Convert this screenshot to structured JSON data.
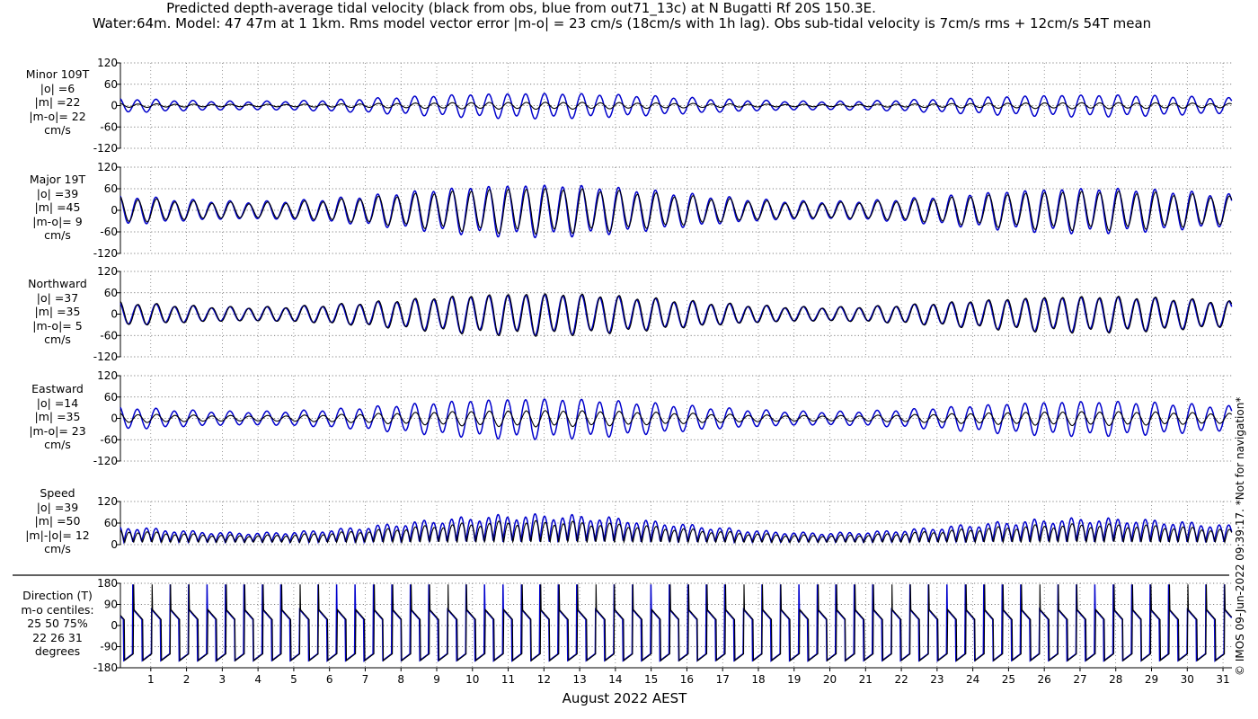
{
  "title": {
    "line1": "Predicted depth-average tidal velocity (black from obs, blue from out71_13c) at N Bugatti Rf 20S 150.3E.",
    "line2": "Water:64m. Model: 47 47m at 1 1km. Rms model vector error |m-o| = 23 cm/s (18cm/s with 1h lag). Obs sub-tidal velocity is 7cm/s rms + 12cm/s 54T mean"
  },
  "copyright": "© IMOS 09-Jun-2022 09:39:17. *Not for navigation*",
  "colors": {
    "obs": "#000000",
    "model": "#0000cc",
    "grid": "#555555"
  },
  "chart_data": [
    {
      "type": "line",
      "id": "minor",
      "label_lines": [
        "Minor 109T",
        "|o| =6",
        "|m| =22",
        "|m-o|= 22",
        "cm/s"
      ],
      "ylim": [
        -120,
        120
      ],
      "yticks": [
        120,
        60,
        0,
        -60,
        -120
      ],
      "obs_amplitude": 6,
      "model_amplitude": 22,
      "series": [
        {
          "name": "obs",
          "amplitude": 6
        },
        {
          "name": "model",
          "amplitude": 22
        }
      ]
    },
    {
      "type": "line",
      "id": "major",
      "label_lines": [
        "Major 19T",
        "|o| =39",
        "|m| =45",
        "|m-o|= 9",
        "cm/s"
      ],
      "ylim": [
        -120,
        120
      ],
      "yticks": [
        120,
        60,
        0,
        -60,
        -120
      ],
      "obs_amplitude": 39,
      "model_amplitude": 45,
      "series": [
        {
          "name": "obs",
          "amplitude": 39
        },
        {
          "name": "model",
          "amplitude": 45
        }
      ]
    },
    {
      "type": "line",
      "id": "north",
      "label_lines": [
        "Northward",
        "|o| =37",
        "|m| =35",
        "|m-o|= 5",
        "cm/s"
      ],
      "ylim": [
        -120,
        120
      ],
      "yticks": [
        120,
        60,
        0,
        -60,
        -120
      ],
      "obs_amplitude": 37,
      "model_amplitude": 35,
      "series": [
        {
          "name": "obs",
          "amplitude": 37
        },
        {
          "name": "model",
          "amplitude": 35
        }
      ]
    },
    {
      "type": "line",
      "id": "east",
      "label_lines": [
        "Eastward",
        "|o| =14",
        "|m| =35",
        "|m-o|= 23",
        "cm/s"
      ],
      "ylim": [
        -120,
        120
      ],
      "yticks": [
        120,
        60,
        0,
        -60,
        -120
      ],
      "obs_amplitude": 14,
      "model_amplitude": 35,
      "series": [
        {
          "name": "obs",
          "amplitude": 14
        },
        {
          "name": "model",
          "amplitude": 35
        }
      ]
    },
    {
      "type": "line",
      "id": "speed",
      "label_lines": [
        "Speed",
        "|o| =39",
        "|m| =50",
        "|m|-|o|= 12",
        "cm/s"
      ],
      "ylim": [
        0,
        120
      ],
      "yticks": [
        120,
        60,
        0
      ],
      "obs_amplitude": 39,
      "model_amplitude": 50,
      "series": [
        {
          "name": "obs",
          "amplitude": 39
        },
        {
          "name": "model",
          "amplitude": 50
        }
      ]
    },
    {
      "type": "line",
      "id": "direction",
      "label_lines": [
        "Direction (T)",
        "m-o centiles:",
        "25  50  75%",
        "22  26  31",
        "degrees"
      ],
      "ylim": [
        -180,
        180
      ],
      "yticks": [
        180,
        90,
        0,
        -90,
        -180
      ],
      "series": [
        {
          "name": "obs"
        },
        {
          "name": "model"
        }
      ]
    }
  ],
  "x_axis": {
    "label": "August 2022 AEST",
    "ticks": [
      "1",
      "2",
      "3",
      "4",
      "5",
      "6",
      "7",
      "8",
      "9",
      "10",
      "11",
      "12",
      "13",
      "14",
      "15",
      "16",
      "17",
      "18",
      "19",
      "20",
      "21",
      "22",
      "23",
      "24",
      "25",
      "26",
      "27",
      "28",
      "29",
      "30",
      "31"
    ],
    "xlim_days": [
      0.15,
      31.25
    ],
    "semidiurnal_period_hours": 12.42,
    "spring_tide_days": [
      11.8,
      27.2
    ],
    "neap_tide_days": [
      4.5,
      19.5
    ]
  }
}
